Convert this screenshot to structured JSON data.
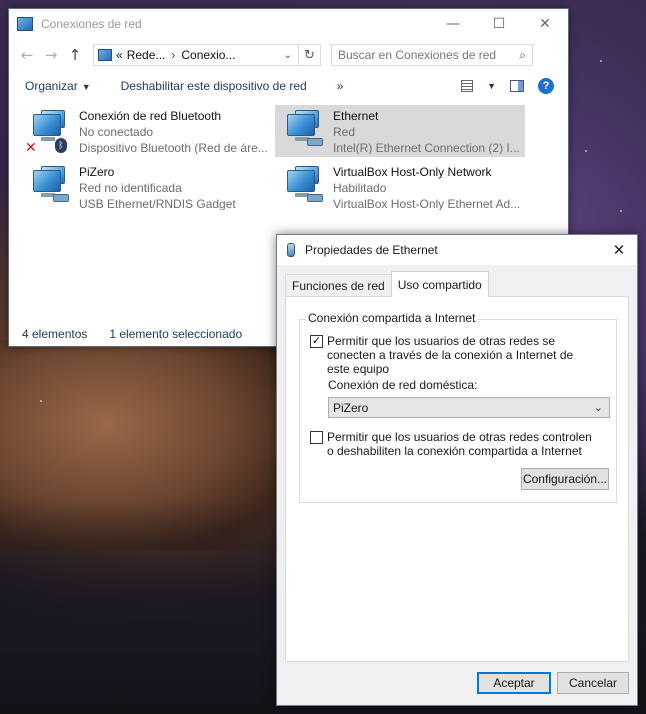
{
  "explorer": {
    "title": "Conexiones de red",
    "address_prefix": "«",
    "address_segments": [
      "Rede...",
      "Conexio..."
    ],
    "search_placeholder": "Buscar en Conexiones de red",
    "toolbar": {
      "organize": "Organizar",
      "disable_device": "Deshabilitar este dispositivo de red",
      "more": "»"
    },
    "items": [
      {
        "name": "Conexión de red Bluetooth",
        "status": "No conectado",
        "device": "Dispositivo Bluetooth (Red de áre...",
        "state": "disconnected-bluetooth",
        "selected": false
      },
      {
        "name": "Ethernet",
        "status": "Red",
        "device": "Intel(R) Ethernet Connection (2) I...",
        "state": "connected",
        "selected": true
      },
      {
        "name": "PiZero",
        "status": "Red no identificada",
        "device": "USB Ethernet/RNDIS Gadget",
        "state": "connected",
        "selected": false
      },
      {
        "name": "VirtualBox Host-Only Network",
        "status": "Habilitado",
        "device": "VirtualBox Host-Only Ethernet Ad...",
        "state": "connected",
        "selected": false
      }
    ],
    "status": {
      "count": "4 elementos",
      "selected": "1 elemento seleccionado"
    }
  },
  "dialog": {
    "title": "Propiedades de Ethernet",
    "tabs": [
      "Funciones de red",
      "Uso compartido"
    ],
    "active_tab": "Uso compartido",
    "group_title": "Conexión compartida a Internet",
    "allow_share": {
      "label": "Permitir que los usuarios de otras redes se conecten a través de la conexión a Internet de este equipo",
      "checked": true
    },
    "home_network_label": "Conexión de red doméstica:",
    "home_network_value": "PiZero",
    "allow_control": {
      "label": "Permitir que los usuarios de otras redes controlen o deshabiliten la conexión compartida a Internet",
      "checked": false
    },
    "settings_button": "Configuración...",
    "ok_button": "Aceptar",
    "cancel_button": "Cancelar"
  },
  "colors": {
    "accent": "#0078d7",
    "selection": "#d9d9d9",
    "link_text": "#1e395b"
  }
}
